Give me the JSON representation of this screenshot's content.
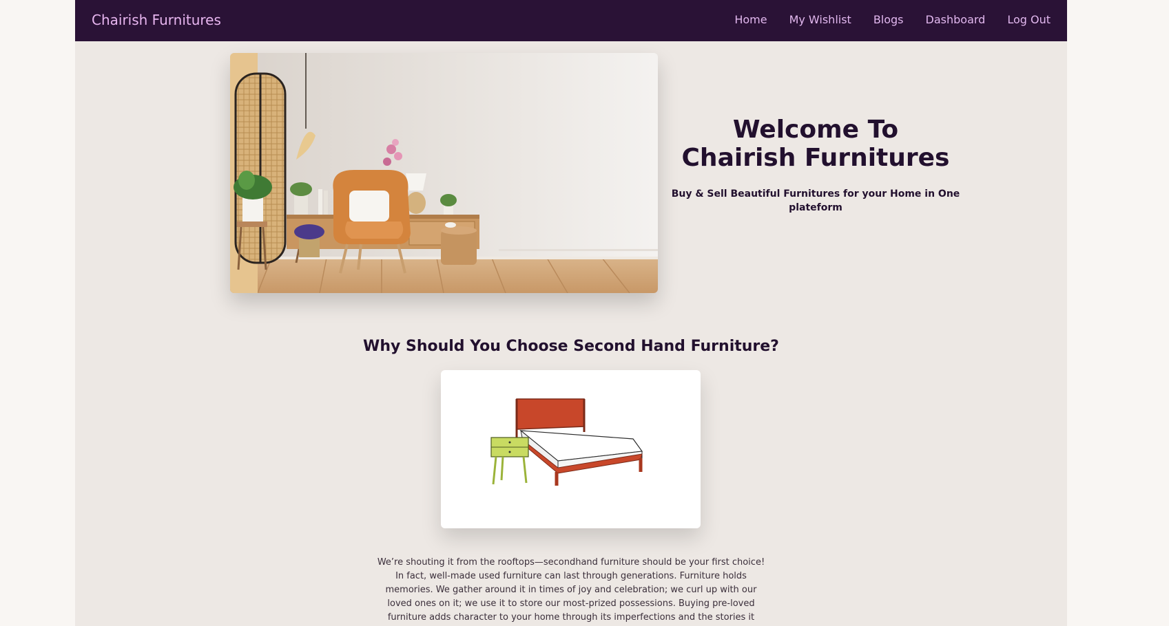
{
  "navbar": {
    "brand": "Chairish Furnitures",
    "links": [
      "Home",
      "My Wishlist",
      "Blogs",
      "Dashboard",
      "Log Out"
    ]
  },
  "hero": {
    "title_line1": "Welcome To",
    "title_line2": "Chairish Furnitures",
    "subtitle": "Buy & Sell Beautiful Furnitures for your Home in One plateform"
  },
  "section": {
    "title": "Why Should You Choose Second Hand Furniture?",
    "body": "We’re shouting it from the rooftops—secondhand furniture should be your first choice! In fact, well-made used furniture can last through generations. Furniture holds memories. We gather around it in times of joy and celebration; we curl up with our loved ones on it; we use it to store our most-prized possessions. Buying pre-loved furniture adds character to your home through its imperfections and the stories it carries. We’re here to continue"
  },
  "colors": {
    "navbar_bg": "#2a1236",
    "nav_text": "#e2b8ef",
    "page_bg": "#ede8e4",
    "heading": "#22102e"
  }
}
